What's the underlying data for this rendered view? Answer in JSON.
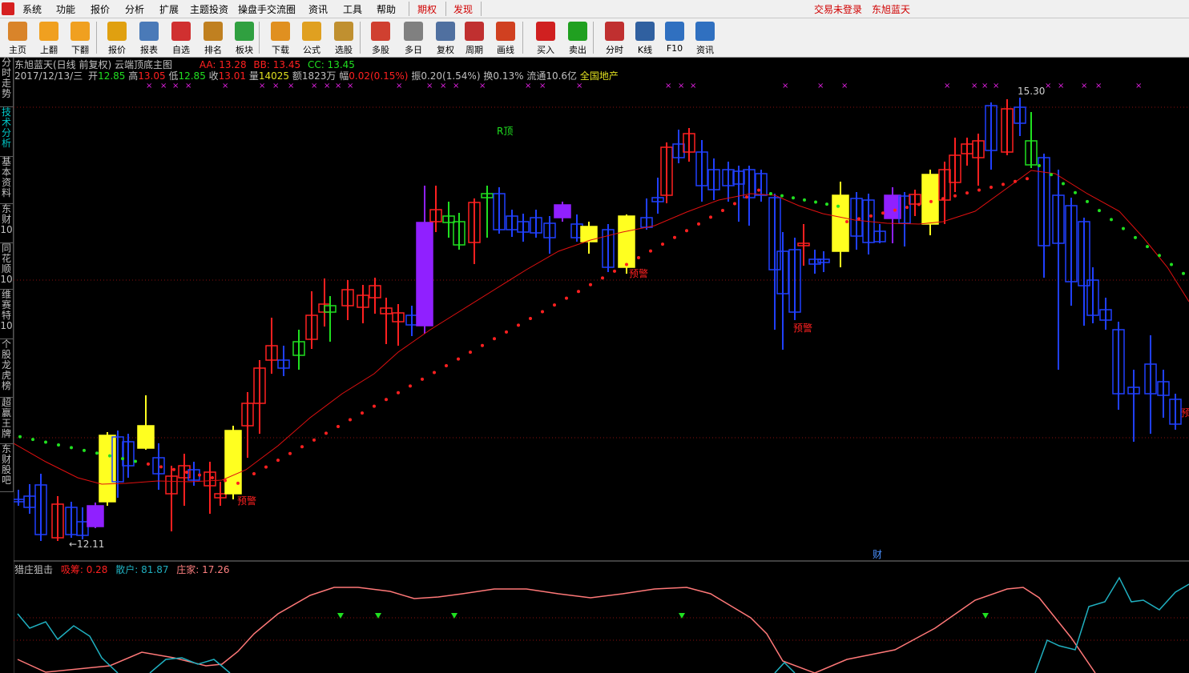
{
  "menu": {
    "items": [
      "系统",
      "功能",
      "报价",
      "分析",
      "扩展",
      "主题投资",
      "操盘手交流圈",
      "资讯",
      "工具",
      "帮助"
    ],
    "special": [
      "期权",
      "发现"
    ],
    "status": "交易未登录",
    "user": "东旭蓝天"
  },
  "toolbar": {
    "buttons": [
      {
        "label": "主页",
        "icon": "home-icon",
        "color": "#d9842a"
      },
      {
        "label": "上翻",
        "icon": "arrow-up-icon",
        "color": "#f0a020"
      },
      {
        "label": "下翻",
        "icon": "arrow-down-icon",
        "color": "#f0a020"
      },
      {
        "label": "报价",
        "icon": "quote-icon",
        "color": "#e0a010"
      },
      {
        "label": "报表",
        "icon": "report-icon",
        "color": "#4a7ab8"
      },
      {
        "label": "自选",
        "icon": "f6-icon",
        "color": "#d03030"
      },
      {
        "label": "排名",
        "icon": "rank-icon",
        "color": "#c08020"
      },
      {
        "label": "板块",
        "icon": "sector-icon",
        "color": "#30a040"
      },
      {
        "label": "下载",
        "icon": "download-icon",
        "color": "#e09020"
      },
      {
        "label": "公式",
        "icon": "formula-icon",
        "color": "#e0a020"
      },
      {
        "label": "选股",
        "icon": "stock-pick-icon",
        "color": "#c09030"
      },
      {
        "label": "多股",
        "icon": "multi-stock-icon",
        "color": "#d04030"
      },
      {
        "label": "多日",
        "icon": "multi-day-icon",
        "color": "#808080"
      },
      {
        "label": "复权",
        "icon": "adjust-icon",
        "color": "#5070a0"
      },
      {
        "label": "周期",
        "icon": "f8-icon",
        "color": "#c03030"
      },
      {
        "label": "画线",
        "icon": "draw-line-icon",
        "color": "#d04020"
      },
      {
        "label": "买入",
        "icon": "buy-icon",
        "color": "#d02020"
      },
      {
        "label": "卖出",
        "icon": "sell-icon",
        "color": "#20a020"
      },
      {
        "label": "分时",
        "icon": "timeline-icon",
        "color": "#c03030"
      },
      {
        "label": "K线",
        "icon": "kline-icon",
        "color": "#3060a0"
      },
      {
        "label": "F10",
        "icon": "f10-icon",
        "color": "#3070c0"
      },
      {
        "label": "资讯",
        "icon": "news-icon",
        "color": "#3070c0"
      }
    ]
  },
  "sidebar": {
    "tabs": [
      "分时走势",
      "技术分析",
      "基本资料",
      "东财10",
      "同花顺10",
      "维赛特10",
      "个股龙虎榜",
      "超赢王牌",
      "东财股吧"
    ],
    "active": "技术分析"
  },
  "main": {
    "title": "东旭蓝天(日线 前复权) 云端顶底主图",
    "aa": "AA: 13.28",
    "bb": "BB: 13.45",
    "cc": "CC: 13.45",
    "info": {
      "date": "2017/12/13/三",
      "open_label": "开",
      "open": "12.85",
      "high_label": "高",
      "high": "13.05",
      "low_label": "低",
      "low": "12.85",
      "close_label": "收",
      "close": "13.01",
      "vol_label": "量",
      "vol": "14025",
      "amt": "额1823万",
      "chg_label": "幅",
      "chg": "0.02(0.15%)",
      "amp": "振0.20(1.54%)",
      "turn": "换0.13%",
      "float": "流通10.6亿",
      "sector": "全国地产"
    },
    "annotations": {
      "high_mark": "15.30",
      "low_mark": "12.11",
      "top_signal": "R顶",
      "warn": "预警",
      "fin": "财"
    }
  },
  "indicator": {
    "name": "猎庄狙击",
    "xichou": "吸筹: 0.28",
    "sanhu": "散户: 81.87",
    "zhuangjia": "庄家: 17.26"
  },
  "colors": {
    "up": "#ff2020",
    "down": "#2040ff",
    "yellow": "#ffff20",
    "purple": "#9020ff",
    "green": "#20e020",
    "ma": "#e01010",
    "pink": "#ff7878",
    "cyan": "#20b0c0"
  }
}
